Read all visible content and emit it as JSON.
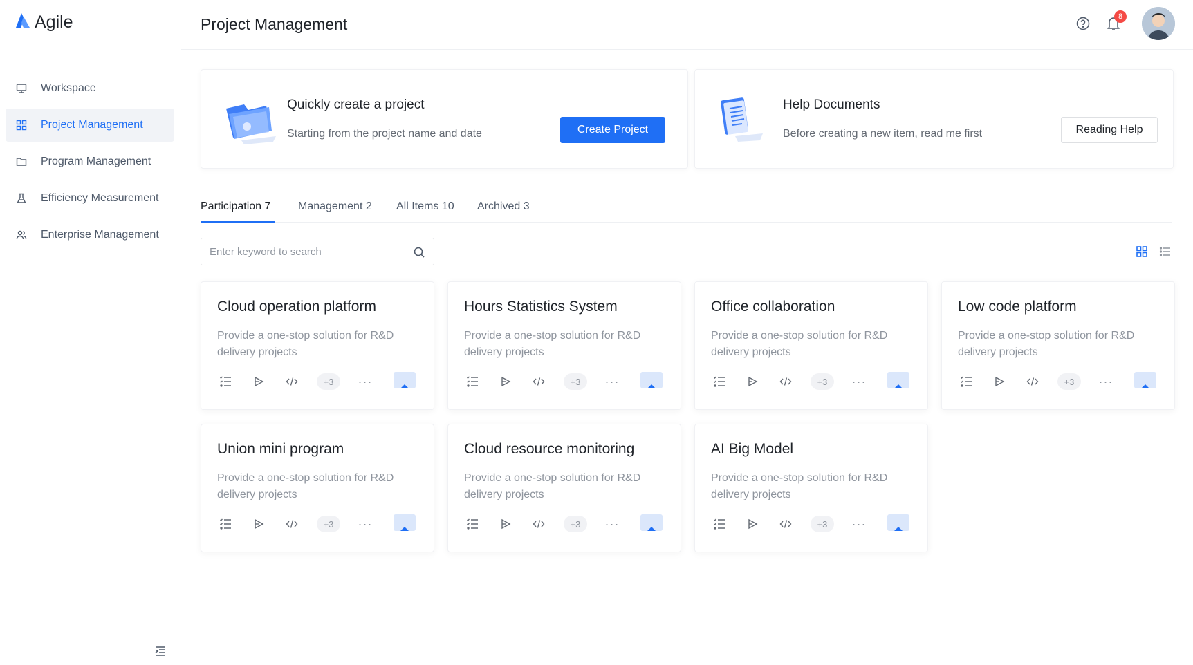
{
  "app": {
    "logo_text": "Agile",
    "brand_color": "#1f6ff5"
  },
  "sidebar": {
    "items": [
      {
        "label": "Workspace",
        "icon": "monitor-icon",
        "active": false
      },
      {
        "label": "Project Management",
        "icon": "grid-icon",
        "active": true
      },
      {
        "label": "Program Management",
        "icon": "folder-icon",
        "active": false
      },
      {
        "label": "Efficiency Measurement",
        "icon": "flask-icon",
        "active": false
      },
      {
        "label": "Enterprise Management",
        "icon": "users-icon",
        "active": false
      }
    ]
  },
  "header": {
    "title": "Project Management",
    "notification_count": "8"
  },
  "banners": {
    "create": {
      "title": "Quickly create a project",
      "subtitle": "Starting from the project name and date",
      "button_label": "Create Project"
    },
    "help": {
      "title": "Help Documents",
      "subtitle": "Before creating a new item,  read me first",
      "button_label": "Reading Help"
    }
  },
  "tabs": [
    {
      "label": "Participation 7",
      "active": true
    },
    {
      "label": "Management 2",
      "active": false
    },
    {
      "label": "All Items 10",
      "active": false
    },
    {
      "label": "Archived 3",
      "active": false
    }
  ],
  "search": {
    "placeholder": "Enter keyword to search",
    "value": ""
  },
  "projects": [
    {
      "title": "Cloud operation platform",
      "desc": "Provide a one-stop solution for R&D delivery projects",
      "extra_badge": "+3"
    },
    {
      "title": "Hours Statistics System",
      "desc": "Provide a one-stop solution for R&D delivery projects",
      "extra_badge": "+3"
    },
    {
      "title": "Office collaboration",
      "desc": "Provide a one-stop solution for R&D delivery projects",
      "extra_badge": "+3"
    },
    {
      "title": "Low code platform",
      "desc": "Provide a one-stop solution for R&D delivery projects",
      "extra_badge": "+3"
    },
    {
      "title": "Union mini program",
      "desc": "Provide a one-stop solution for R&D delivery projects",
      "extra_badge": "+3"
    },
    {
      "title": "Cloud resource monitoring",
      "desc": "Provide a one-stop solution for R&D delivery projects",
      "extra_badge": "+3"
    },
    {
      "title": "AI Big Model",
      "desc": "Provide a one-stop solution for R&D delivery projects",
      "extra_badge": "+3"
    }
  ]
}
